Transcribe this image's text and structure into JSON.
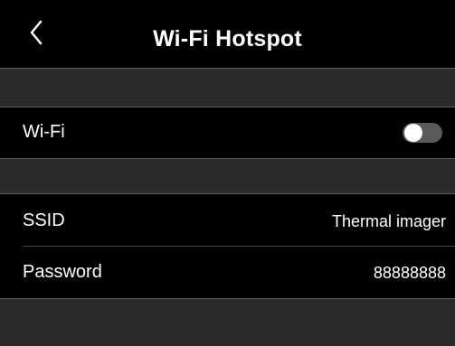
{
  "header": {
    "title": "Wi-Fi Hotspot",
    "back_icon": "chevron-left-icon"
  },
  "wifi": {
    "label": "Wi-Fi",
    "enabled": false
  },
  "details": {
    "ssid_label": "SSID",
    "ssid_value": "Thermal imager",
    "password_label": "Password",
    "password_value": "88888888"
  },
  "colors": {
    "row_background": "#000000",
    "section_background": "#2b2b2b",
    "text": "#ffffff",
    "toggle_off": "#5a5a5a"
  }
}
